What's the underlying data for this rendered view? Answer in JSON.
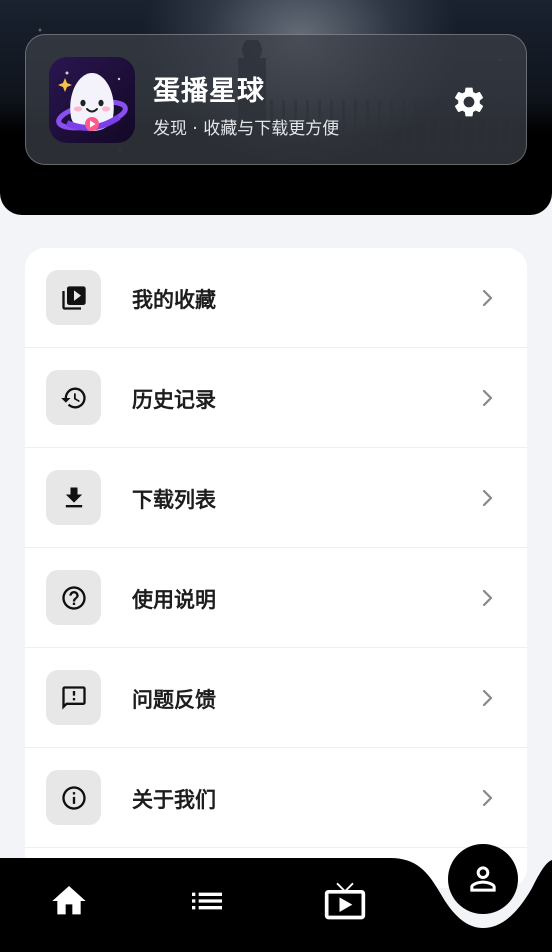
{
  "header": {
    "app_title": "蛋播星球",
    "app_subtitle": "发现 · 收藏与下载更方便",
    "logo_icon": "app-logo-egg-planet",
    "settings_icon": "gear-icon"
  },
  "menu": {
    "items": [
      {
        "label": "我的收藏",
        "icon": "video-library-icon"
      },
      {
        "label": "历史记录",
        "icon": "history-icon"
      },
      {
        "label": "下载列表",
        "icon": "download-icon"
      },
      {
        "label": "使用说明",
        "icon": "help-circle-icon"
      },
      {
        "label": "问题反馈",
        "icon": "feedback-icon"
      },
      {
        "label": "关于我们",
        "icon": "info-icon"
      }
    ]
  },
  "bottom_nav": {
    "items": [
      {
        "icon": "home-icon"
      },
      {
        "icon": "list-icon"
      },
      {
        "icon": "tv-icon"
      },
      {
        "icon": "profile-icon",
        "active": true
      }
    ]
  },
  "colors": {
    "page_bg": "#f3f4f8",
    "card_bg": "#ffffff",
    "icon_box_bg": "#e7e7e7",
    "nav_bg": "#000000",
    "text_primary": "#1d1d1f"
  }
}
